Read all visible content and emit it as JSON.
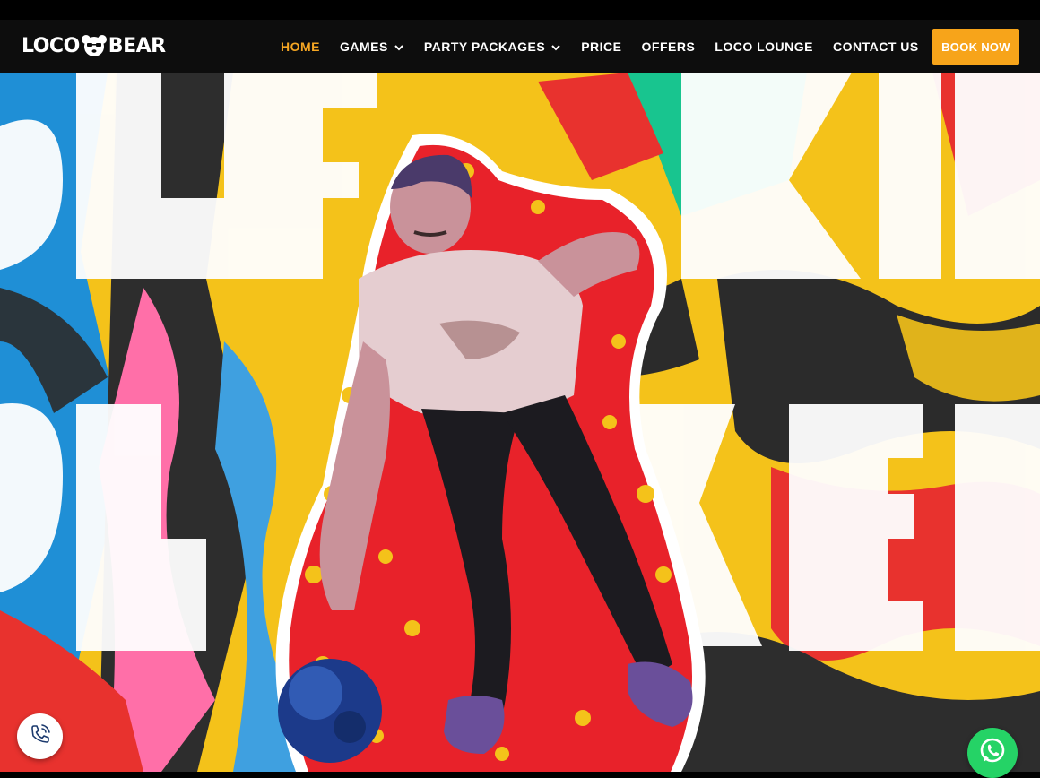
{
  "brand": {
    "name_left": "LOCO",
    "name_right": "BEAR"
  },
  "nav": {
    "home": "HOME",
    "games": "GAMES",
    "party_packages": "PARTY PACKAGES",
    "price": "PRICE",
    "offers": "OFFERS",
    "loco_lounge": "LOCO LOUNGE",
    "contact_us": "CONTACT US",
    "book_now": "BOOK NOW"
  },
  "colors": {
    "accent": "#f5a623",
    "nav_bg": "#0d0d0d",
    "book_bg": "#f7a41a",
    "whatsapp": "#25d366"
  },
  "icons": {
    "call": "phone-call-icon",
    "whatsapp": "whatsapp-icon",
    "dropdown": "chevron-down-icon"
  }
}
